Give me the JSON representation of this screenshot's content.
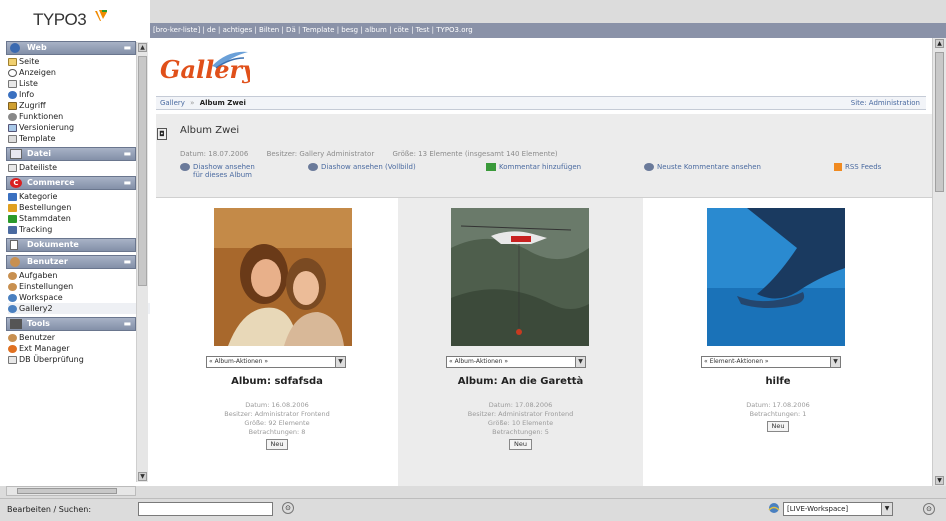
{
  "app": {
    "logo_text": "TYPO3"
  },
  "topbar": {
    "text": "[bro-ker-liste] | de | achtiges | Bilten | Dä | Template | besg | album | cöte | Test | TYPO3.org"
  },
  "sidebar": {
    "groups": [
      {
        "label": "Web",
        "items": [
          "Seite",
          "Anzeigen",
          "Liste",
          "Info",
          "Zugriff",
          "Funktionen",
          "Versionierung",
          "Template"
        ]
      },
      {
        "label": "Datei",
        "items": [
          "Dateiliste"
        ]
      },
      {
        "label": "Commerce",
        "items": [
          "Kategorie",
          "Bestellungen",
          "Stammdaten",
          "Tracking"
        ]
      },
      {
        "label": "Dokumente",
        "items": []
      },
      {
        "label": "Benutzer",
        "items": [
          "Aufgaben",
          "Einstellungen",
          "Workspace",
          "Gallery2"
        ]
      },
      {
        "label": "Tools",
        "items": [
          "Benutzer",
          "Ext Manager",
          "DB Überprüfung"
        ]
      }
    ]
  },
  "content": {
    "gallery_logo": "Gallery",
    "breadcrumb": {
      "root": "Gallery",
      "sep": "»",
      "current": "Album Zwei",
      "site_link": "Site: Administration"
    },
    "album": {
      "title": "Album Zwei",
      "meta": [
        "Datum: 18.07.2006",
        "Besitzer: Gallery Administrator",
        "Größe: 13 Elemente (insgesamt 140 Elemente)"
      ],
      "actions": [
        {
          "line1": "Diashow ansehen",
          "line2": "für dieses Album"
        },
        {
          "line1": "Diashow ansehen (Vollbild)",
          "line2": ""
        },
        {
          "line1": "Kommentar hinzufügen",
          "line2": ""
        },
        {
          "line1": "Neuste Kommentare ansehen",
          "line2": ""
        },
        {
          "line1": "RSS Feeds",
          "line2": ""
        }
      ]
    },
    "items": [
      {
        "select": "« Album-Aktionen »",
        "title": "Album: sdfafsda",
        "info": [
          "Datum: 16.08.2006",
          "Besitzer: Administrator Frontend",
          "Größe: 92 Elemente",
          "Betrachtungen: 8"
        ],
        "badge": "Neu"
      },
      {
        "select": "« Album-Aktionen »",
        "title": "Album: An die Garettà",
        "info": [
          "Datum: 17.08.2006",
          "Besitzer: Administrator Frontend",
          "Größe: 10 Elemente",
          "Betrachtungen: 5"
        ],
        "badge": "Neu"
      },
      {
        "select": "« Element-Aktionen »",
        "title": "hilfe",
        "info": [
          "Datum: 17.08.2006",
          "Betrachtungen: 1"
        ],
        "badge": "Neu"
      }
    ]
  },
  "bottom": {
    "search_label": "Bearbeiten / Suchen:",
    "search_value": "",
    "workspace_value": "[LIVE-Workspace]"
  },
  "colors": {
    "header_bar": "#8a92a8",
    "group_header": "#8390a8",
    "link": "#4a6aa0",
    "shaded_col": "#ececec"
  }
}
